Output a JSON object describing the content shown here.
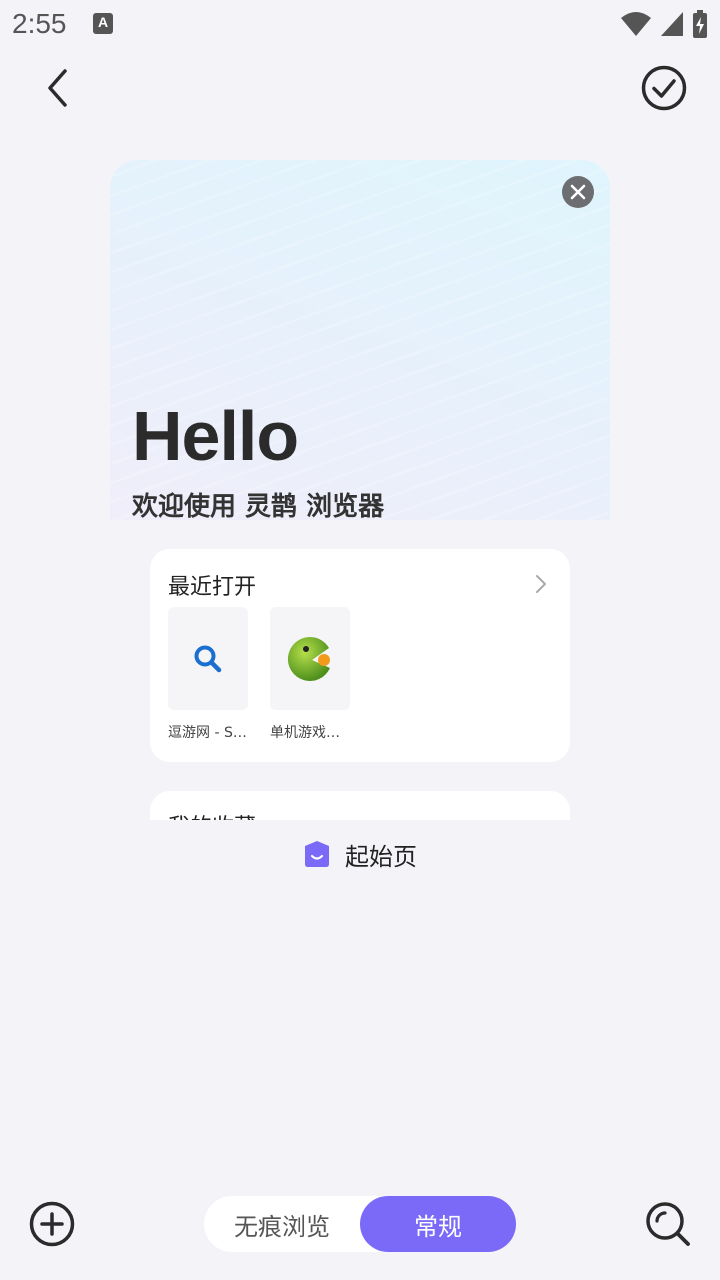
{
  "status_bar": {
    "time": "2:55",
    "notification_letter": "A",
    "icons": [
      "wifi-icon",
      "signal-icon",
      "battery-charging-icon"
    ]
  },
  "top_bar": {
    "back_icon": "chevron-left-icon",
    "done_icon": "check-circle-icon"
  },
  "tab_card": {
    "hello": "Hello",
    "welcome": "欢迎使用 灵鹊 浏览器",
    "recent": {
      "title": "最近打开",
      "items": [
        {
          "label": "逗游网 - Se...",
          "icon": "search-icon"
        },
        {
          "label": "单机游戏下...",
          "icon": "game-logo-icon"
        }
      ]
    },
    "favorites_title": "我的收藏"
  },
  "tab_label": "起始页",
  "bottom_bar": {
    "incognito_label": "无痕浏览",
    "normal_label": "常规"
  },
  "colors": {
    "accent": "#7a6af7",
    "background": "#f4f3f8"
  }
}
